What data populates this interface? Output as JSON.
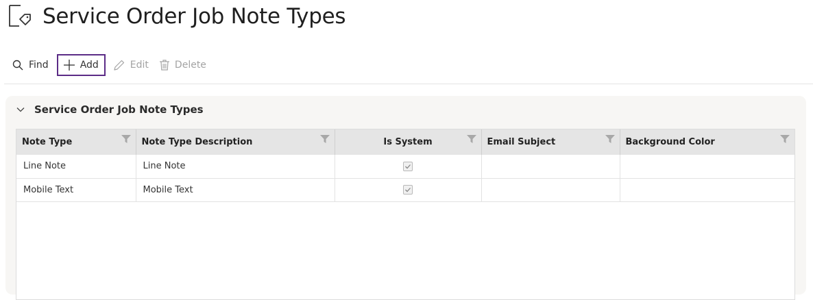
{
  "page": {
    "title": "Service Order Job Note Types",
    "icon": "document-tag-icon"
  },
  "toolbar": {
    "find_label": "Find",
    "add_label": "Add",
    "edit_label": "Edit",
    "delete_label": "Delete"
  },
  "panel": {
    "title": "Service Order Job Note Types",
    "expanded": true
  },
  "grid": {
    "columns": [
      "Note Type",
      "Note Type Description",
      "Is System",
      "Email Subject",
      "Background Color"
    ],
    "rows": [
      {
        "note_type": "Line Note",
        "description": "Line Note",
        "is_system": true,
        "email_subject": "",
        "background_color": ""
      },
      {
        "note_type": "Mobile Text",
        "description": "Mobile Text",
        "is_system": true,
        "email_subject": "",
        "background_color": ""
      }
    ]
  },
  "colors": {
    "focus_border": "#5b2b86",
    "header_bg": "#e5e5e5",
    "panel_bg": "#f7f6f4"
  }
}
